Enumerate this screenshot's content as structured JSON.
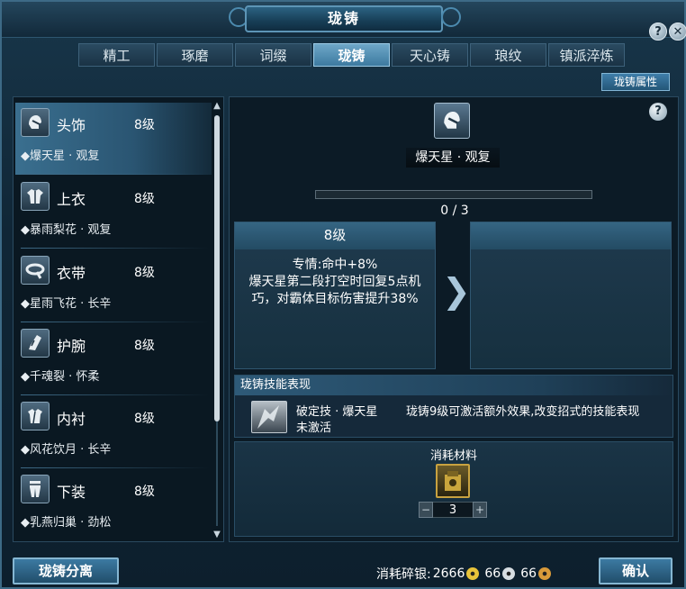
{
  "window": {
    "title": "珑铸"
  },
  "header_buttons": {
    "help": "?",
    "close": "✕"
  },
  "tabs": [
    {
      "label": "精工",
      "active": false
    },
    {
      "label": "琢磨",
      "active": false
    },
    {
      "label": "词缀",
      "active": false
    },
    {
      "label": "珑铸",
      "active": true
    },
    {
      "label": "天心铸",
      "active": false
    },
    {
      "label": "琅纹",
      "active": false
    },
    {
      "label": "镇派淬炼",
      "active": false
    }
  ],
  "attr_button": "珑铸属性",
  "equipment_slots": [
    {
      "name": "头饰",
      "level": "8级",
      "skill": "◆爆天星 · 观复",
      "icon": "helmet-icon",
      "selected": true
    },
    {
      "name": "上衣",
      "level": "8级",
      "skill": "◆暴雨梨花 · 观复",
      "icon": "chest-armor-icon",
      "selected": false
    },
    {
      "name": "衣带",
      "level": "8级",
      "skill": "◆星雨飞花 · 长辛",
      "icon": "belt-icon",
      "selected": false
    },
    {
      "name": "护腕",
      "level": "8级",
      "skill": "◆千魂裂 · 怀柔",
      "icon": "bracer-icon",
      "selected": false
    },
    {
      "name": "内衬",
      "level": "8级",
      "skill": "◆风花饮月 · 长辛",
      "icon": "undershirt-icon",
      "selected": false
    },
    {
      "name": "下装",
      "level": "8级",
      "skill": "◆乳燕归巢 · 劲松",
      "icon": "pants-icon",
      "selected": false
    }
  ],
  "detail": {
    "item_name": "爆天星 · 观复",
    "progress_text": "0 / 3",
    "progress_fraction": 0,
    "current_card": {
      "level": "8级",
      "line1": "专情:命中+8%",
      "line2": "爆天星第二段打空时回复5点机巧，对霸体目标伤害提升38%"
    },
    "next_card": {
      "level": ""
    },
    "skill_section": {
      "title": "珑铸技能表现",
      "skill_name": "破定技 · 爆天星",
      "state": "未激活",
      "desc": "珑铸9级可激活额外效果,改变招式的技能表现"
    },
    "materials": {
      "title": "消耗材料",
      "quantity": "3",
      "minus": "−",
      "plus": "+"
    }
  },
  "footer": {
    "separate_button": "珑铸分离",
    "cost_label": "消耗碎银:",
    "cost_gold": "2666",
    "cost_silver": "66",
    "cost_copper": "66",
    "confirm_button": "确认"
  },
  "colors": {
    "gold_coin": "#e7c33a",
    "silver_coin": "#d7dde2",
    "copper_coin": "#d89a3a"
  }
}
